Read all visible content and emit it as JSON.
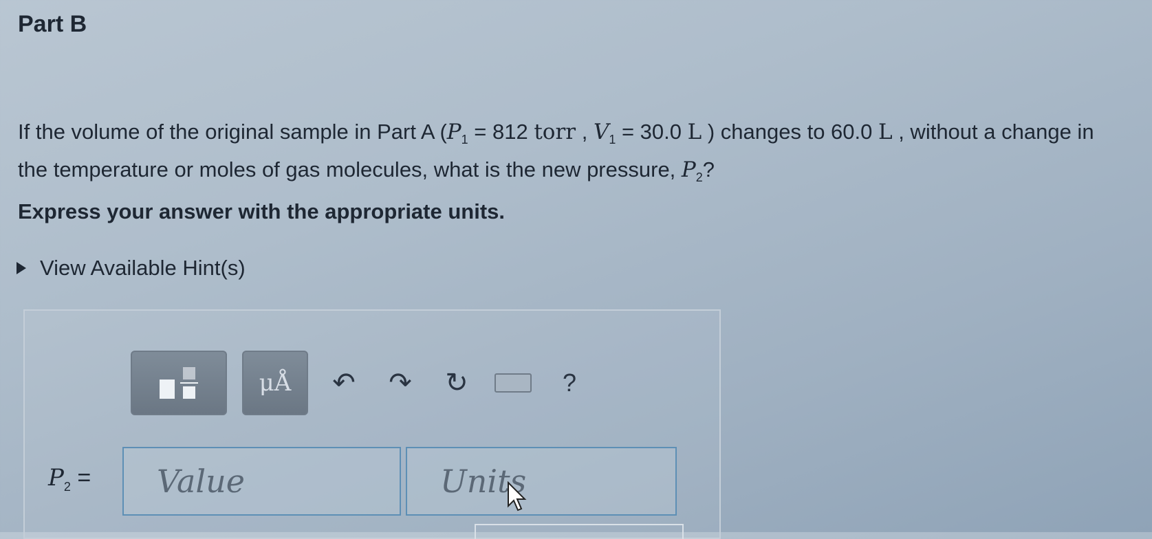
{
  "part": {
    "title": "Part B"
  },
  "question": {
    "text_1": "If the volume of the original sample in Part A (",
    "p1_symbol": "P",
    "p1_sub": "1",
    "p1_value": " = 812 ",
    "p1_unit": "torr",
    "sep": " , ",
    "v1_symbol": "V",
    "v1_sub": "1",
    "v1_value": " = 30.0 ",
    "v1_unit": "L",
    "text_2": " ) changes to 60.0 ",
    "v2_unit": "L",
    "text_3": " , without a change in the temperature or moles of gas molecules, what is the new pressure, ",
    "p2_symbol": "P",
    "p2_sub": "2",
    "text_4": "?"
  },
  "instruction": "Express your answer with the appropriate units.",
  "hints": {
    "label": "View Available Hint(s)"
  },
  "toolbar": {
    "units_label": "μÅ",
    "help_label": "?",
    "icons": [
      "templates-icon",
      "units-icon",
      "undo-icon",
      "redo-icon",
      "reset-icon",
      "keyboard-icon",
      "help-icon"
    ]
  },
  "answer": {
    "label_symbol": "P",
    "label_sub": "2",
    "label_eq": " =",
    "value_placeholder": "Value",
    "units_placeholder": "Units"
  }
}
